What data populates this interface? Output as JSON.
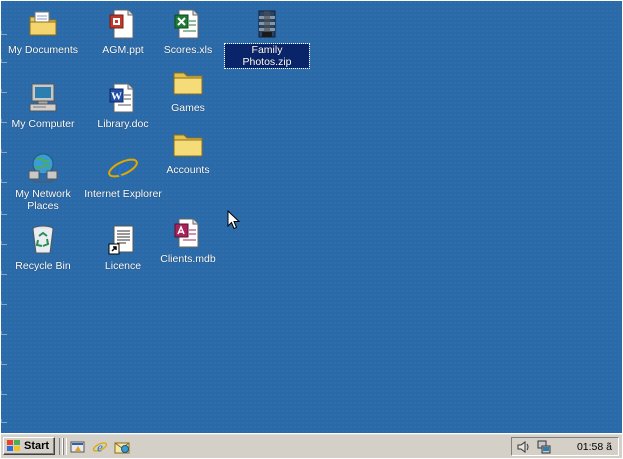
{
  "desktop": {
    "icons": [
      {
        "label": "My Documents",
        "icon": "my-documents-icon"
      },
      {
        "label": "AGM.ppt",
        "icon": "powerpoint-file-icon"
      },
      {
        "label": "Scores.xls",
        "icon": "excel-file-icon"
      },
      {
        "label": "Family Photos.zip",
        "icon": "zip-archive-icon",
        "selected": true
      },
      {
        "label": "My Computer",
        "icon": "my-computer-icon"
      },
      {
        "label": "Library.doc",
        "icon": "word-file-icon"
      },
      {
        "label": "Games",
        "icon": "folder-icon"
      },
      {
        "label": "My Network Places",
        "icon": "network-places-icon"
      },
      {
        "label": "Internet Explorer",
        "icon": "internet-explorer-icon"
      },
      {
        "label": "Accounts",
        "icon": "folder-icon"
      },
      {
        "label": "Recycle Bin",
        "icon": "recycle-bin-icon"
      },
      {
        "label": "Licence",
        "icon": "shortcut-document-icon"
      },
      {
        "label": "Clients.mdb",
        "icon": "access-database-icon"
      }
    ]
  },
  "taskbar": {
    "start_label": "Start",
    "quick_launch": [
      "show-desktop-icon",
      "internet-explorer-icon",
      "outlook-express-icon"
    ],
    "tray_icons": [
      "speaker-icon",
      "network-status-icon"
    ],
    "clock": "01:58 ã"
  },
  "colors": {
    "desktop": "#2a6aa9",
    "taskbar": "#d4d0c8",
    "selection": "#0a246a"
  }
}
